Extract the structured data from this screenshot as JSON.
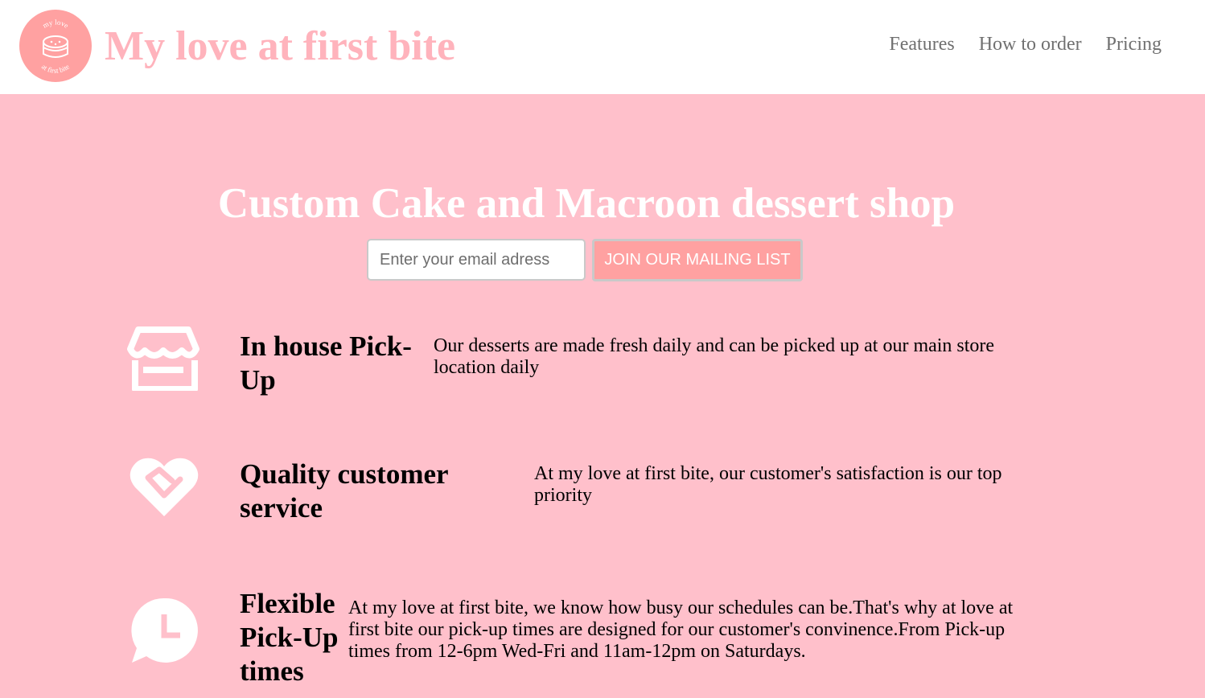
{
  "header": {
    "logo": {
      "icon": "cake-logo-icon",
      "text_top": "my love",
      "text_bottom": "at first bite"
    },
    "title": "My love at first bite",
    "nav": [
      {
        "label": "Features"
      },
      {
        "label": "How to order"
      },
      {
        "label": "Pricing"
      }
    ]
  },
  "hero": {
    "heading": "Custom Cake and Macroon dessert shop",
    "email_placeholder": "Enter your email adress",
    "email_value": "",
    "join_button": "JOIN OUR MAILING LIST"
  },
  "features": [
    {
      "icon": "storefront-icon",
      "title": "In house Pick-Up",
      "text": "Our desserts are made fresh daily and can be picked up at our main store location daily"
    },
    {
      "icon": "heart-handshake-icon",
      "title": "Quality customer service",
      "text": "At my love at first bite, our customer's satisfaction is our top priority"
    },
    {
      "icon": "clock-chat-icon",
      "title": "Flexible Pick-Up times",
      "text": "At my love at first bite, we know how busy our schedules can be.That's why at love at first bite our pick-up times are designed for our customer's convinence.From Pick-up times from 12-6pm Wed-Fri and 11am-12pm on Saturdays."
    }
  ],
  "colors": {
    "page_background": "#ffc0cb",
    "brand_pink": "#ffb3bc",
    "accent": "#ffa1a1",
    "nav_text": "#707070"
  }
}
